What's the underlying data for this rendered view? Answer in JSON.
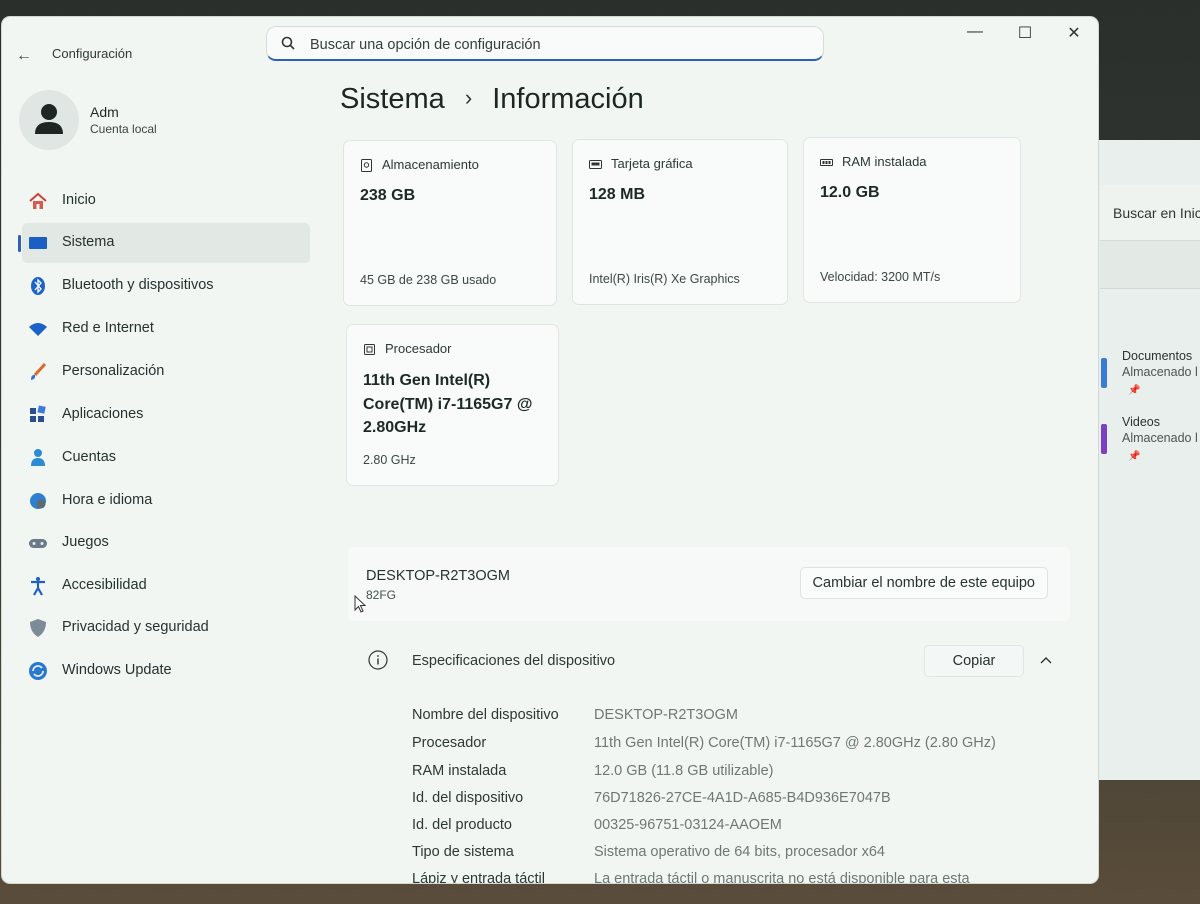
{
  "app": {
    "title": "Configuración",
    "search_placeholder": "Buscar una opción de configuración"
  },
  "user": {
    "name": "Adm",
    "account_type": "Cuenta local"
  },
  "sidebar": {
    "items": [
      {
        "label": "Inicio",
        "icon": "home-icon"
      },
      {
        "label": "Sistema",
        "icon": "monitor-icon",
        "active": true
      },
      {
        "label": "Bluetooth y dispositivos",
        "icon": "bluetooth-icon"
      },
      {
        "label": "Red e Internet",
        "icon": "wifi-icon"
      },
      {
        "label": "Personalización",
        "icon": "brush-icon"
      },
      {
        "label": "Aplicaciones",
        "icon": "apps-icon"
      },
      {
        "label": "Cuentas",
        "icon": "person-icon"
      },
      {
        "label": "Hora e idioma",
        "icon": "globe-clock-icon"
      },
      {
        "label": "Juegos",
        "icon": "gamepad-icon"
      },
      {
        "label": "Accesibilidad",
        "icon": "accessibility-icon"
      },
      {
        "label": "Privacidad y seguridad",
        "icon": "shield-icon"
      },
      {
        "label": "Windows Update",
        "icon": "update-icon"
      }
    ]
  },
  "breadcrumb": {
    "parent": "Sistema",
    "separator": "›",
    "current": "Información"
  },
  "cards": {
    "storage": {
      "title": "Almacenamiento",
      "value": "238 GB",
      "footer": "45 GB de 238 GB usado"
    },
    "gpu": {
      "title": "Tarjeta gráfica",
      "value": "128 MB",
      "footer": "Intel(R) Iris(R) Xe Graphics"
    },
    "ram": {
      "title": "RAM instalada",
      "value": "12.0 GB",
      "footer": "Velocidad: 3200 MT/s"
    },
    "cpu": {
      "title": "Procesador",
      "value": "11th Gen Intel(R) Core(TM) i7-1165G7 @ 2.80GHz",
      "footer": "2.80 GHz"
    }
  },
  "device": {
    "name": "DESKTOP-R2T3OGM",
    "model": "82FG",
    "rename_label": "Cambiar el nombre de este equipo"
  },
  "specs": {
    "title": "Especificaciones del dispositivo",
    "copy_label": "Copiar",
    "rows": [
      {
        "label": "Nombre del dispositivo",
        "value": "DESKTOP-R2T3OGM"
      },
      {
        "label": "Procesador",
        "value": "11th Gen Intel(R) Core(TM) i7-1165G7 @ 2.80GHz (2.80 GHz)"
      },
      {
        "label": "RAM instalada",
        "value": "12.0 GB (11.8 GB utilizable)"
      },
      {
        "label": "Id. del dispositivo",
        "value": "76D71826-27CE-4A1D-A685-B4D936E7047B"
      },
      {
        "label": "Id. del producto",
        "value": "00325-96751-03124-AAOEM"
      },
      {
        "label": "Tipo de sistema",
        "value": "Sistema operativo de 64 bits, procesador x64"
      },
      {
        "label": "Lápiz y entrada táctil",
        "value": "La entrada táctil o manuscrita no está disponible para esta"
      }
    ]
  },
  "background_window": {
    "search_text": "Buscar en Inic",
    "items": [
      {
        "name": "Documentos",
        "sub": "Almacenado l"
      },
      {
        "name": "Videos",
        "sub": "Almacenado l"
      }
    ]
  },
  "colors": {
    "accent": "#2d5fb8",
    "window_bg": "#f1f6f3",
    "card_bg": "#f8fbf9"
  }
}
